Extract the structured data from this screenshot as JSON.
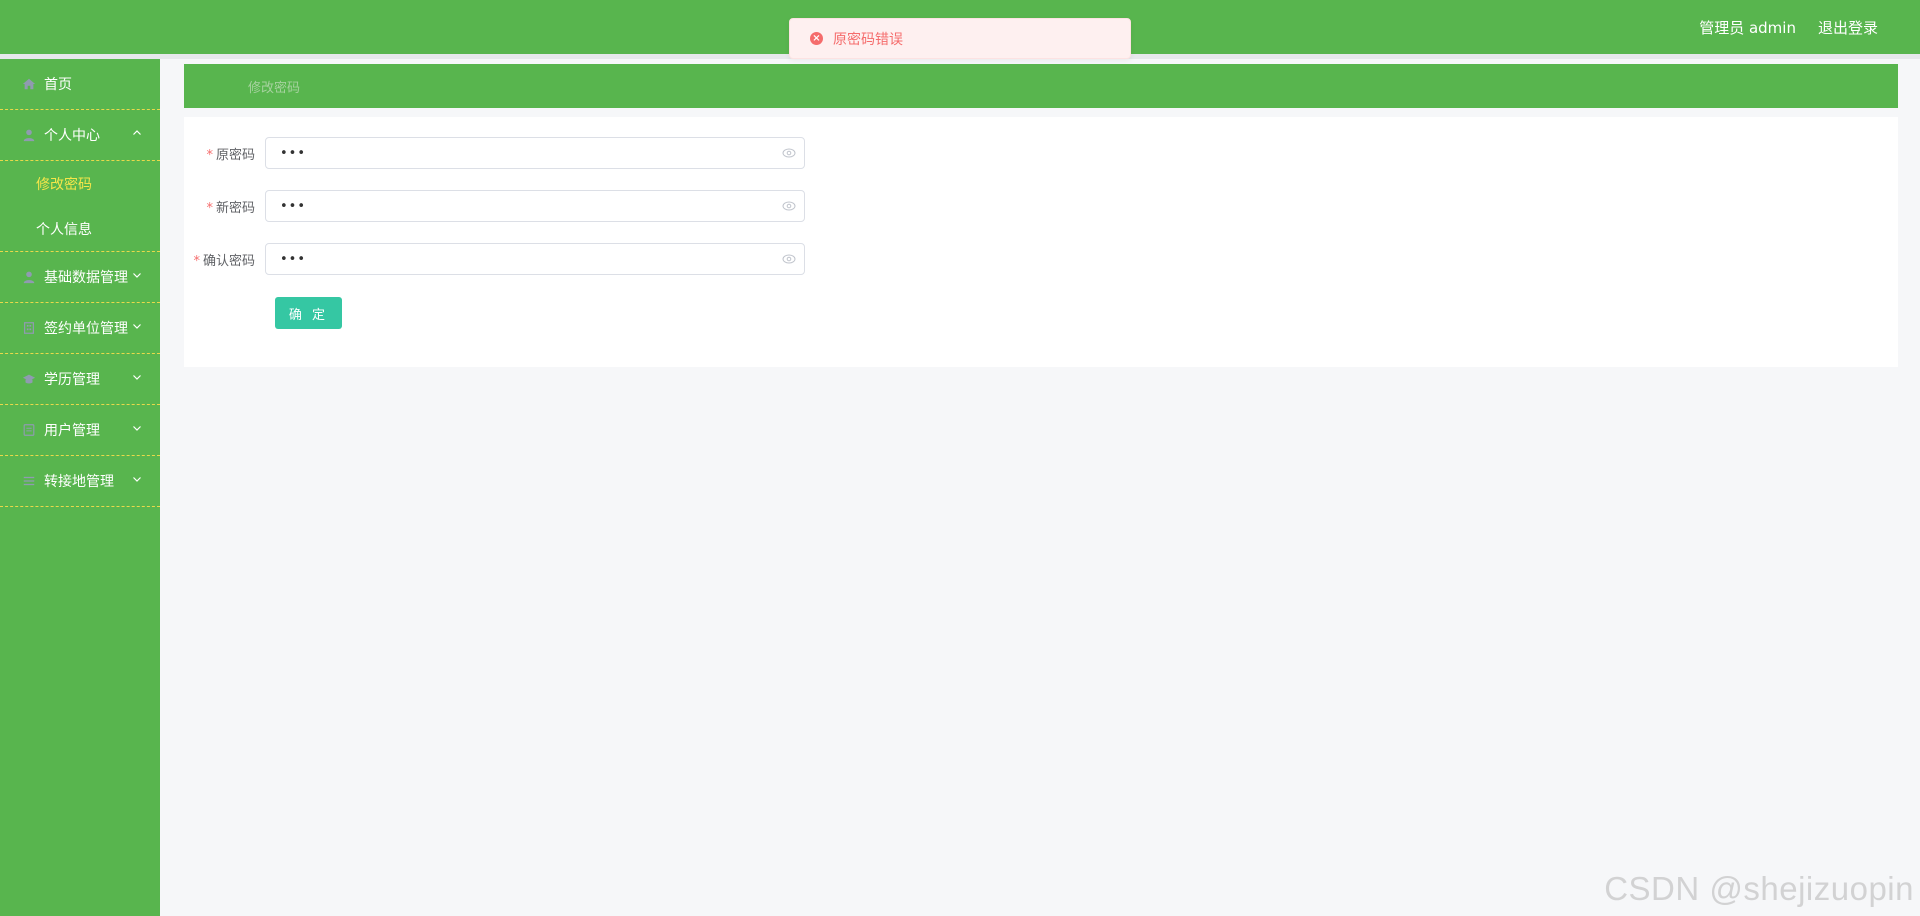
{
  "header": {
    "user_label": "管理员 admin",
    "logout_label": "退出登录"
  },
  "toast": {
    "message": "原密码错误",
    "icon": "error-circle-icon",
    "color": "#f56c6c"
  },
  "sidebar": {
    "items": [
      {
        "label": "首页",
        "icon": "home-icon"
      },
      {
        "label": "个人中心",
        "icon": "user-icon",
        "expanded": true,
        "children": [
          {
            "label": "修改密码",
            "active": true
          },
          {
            "label": "个人信息",
            "active": false
          }
        ]
      },
      {
        "label": "基础数据管理",
        "icon": "user-icon"
      },
      {
        "label": "签约单位管理",
        "icon": "building-icon"
      },
      {
        "label": "学历管理",
        "icon": "graduation-icon"
      },
      {
        "label": "用户管理",
        "icon": "list-icon"
      },
      {
        "label": "转接地管理",
        "icon": "menu-icon"
      }
    ]
  },
  "breadcrumb": {
    "title": "修改密码"
  },
  "form": {
    "fields": [
      {
        "label": "原密码",
        "required": true,
        "value": "•••"
      },
      {
        "label": "新密码",
        "required": true,
        "value": "•••"
      },
      {
        "label": "确认密码",
        "required": true,
        "value": "•••"
      }
    ],
    "submit_label": "确 定"
  },
  "watermark": "CSDN @shejizuopin",
  "colors": {
    "primary_green": "#58b54e",
    "active_yellow": "#f5e64a",
    "button_teal": "#35c7a3",
    "error_red": "#f56c6c"
  }
}
